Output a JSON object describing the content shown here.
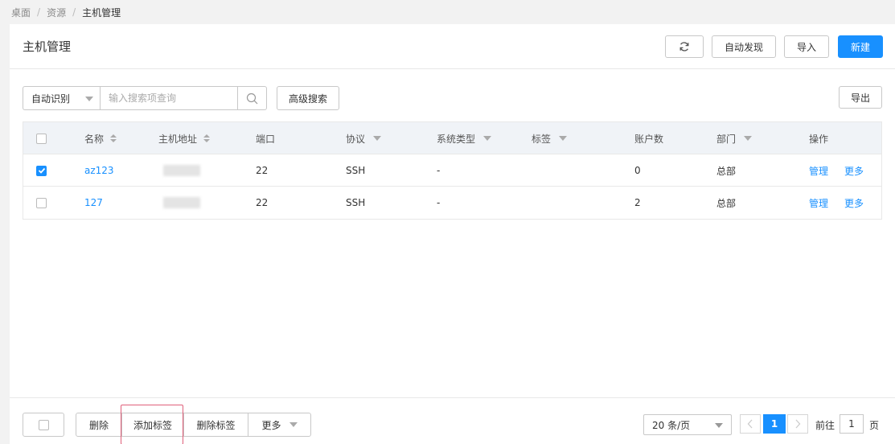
{
  "breadcrumb": [
    "桌面",
    "资源",
    "主机管理"
  ],
  "breadcrumb_sep": "/",
  "header": {
    "title": "主机管理",
    "buttons": {
      "auto_discover": "自动发现",
      "import": "导入",
      "new": "新建"
    }
  },
  "toolbar": {
    "select_value": "自动识别",
    "search_placeholder": "输入搜索项查询",
    "advanced_search": "高级搜索",
    "export": "导出"
  },
  "table": {
    "columns": {
      "name": "名称",
      "address": "主机地址",
      "port": "端口",
      "protocol": "协议",
      "system_type": "系统类型",
      "tag": "标签",
      "accounts": "账户数",
      "department": "部门",
      "actions": "操作"
    },
    "rows": [
      {
        "checked": true,
        "name": "az123",
        "port": "22",
        "protocol": "SSH",
        "system_type": "-",
        "tag": "",
        "accounts": "0",
        "department": "总部",
        "manage": "管理",
        "more": "更多"
      },
      {
        "checked": false,
        "name": "127",
        "port": "22",
        "protocol": "SSH",
        "system_type": "-",
        "tag": "",
        "accounts": "2",
        "department": "总部",
        "manage": "管理",
        "more": "更多"
      }
    ]
  },
  "footer": {
    "delete": "删除",
    "add_tag": "添加标签",
    "remove_tag": "删除标签",
    "more": "更多",
    "page_size": "20 条/页",
    "current_page": "1",
    "goto_prefix": "前往",
    "goto_value": "1",
    "goto_suffix": "页"
  },
  "colors": {
    "primary": "#1890ff",
    "highlight": "#e0607a"
  }
}
